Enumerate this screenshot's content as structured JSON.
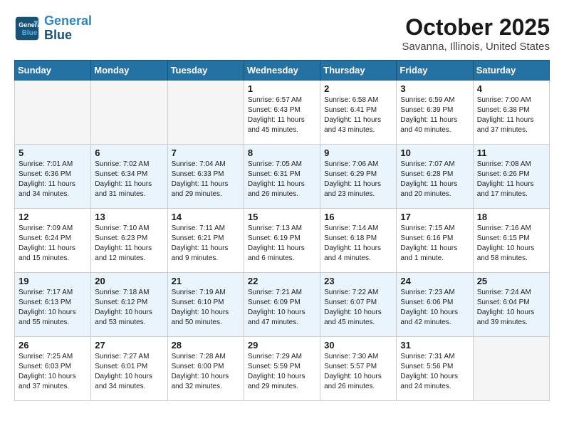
{
  "header": {
    "logo_line1": "General",
    "logo_line2": "Blue",
    "title": "October 2025",
    "subtitle": "Savanna, Illinois, United States"
  },
  "weekdays": [
    "Sunday",
    "Monday",
    "Tuesday",
    "Wednesday",
    "Thursday",
    "Friday",
    "Saturday"
  ],
  "weeks": [
    [
      {
        "day": "",
        "info": ""
      },
      {
        "day": "",
        "info": ""
      },
      {
        "day": "",
        "info": ""
      },
      {
        "day": "1",
        "info": "Sunrise: 6:57 AM\nSunset: 6:43 PM\nDaylight: 11 hours\nand 45 minutes."
      },
      {
        "day": "2",
        "info": "Sunrise: 6:58 AM\nSunset: 6:41 PM\nDaylight: 11 hours\nand 43 minutes."
      },
      {
        "day": "3",
        "info": "Sunrise: 6:59 AM\nSunset: 6:39 PM\nDaylight: 11 hours\nand 40 minutes."
      },
      {
        "day": "4",
        "info": "Sunrise: 7:00 AM\nSunset: 6:38 PM\nDaylight: 11 hours\nand 37 minutes."
      }
    ],
    [
      {
        "day": "5",
        "info": "Sunrise: 7:01 AM\nSunset: 6:36 PM\nDaylight: 11 hours\nand 34 minutes."
      },
      {
        "day": "6",
        "info": "Sunrise: 7:02 AM\nSunset: 6:34 PM\nDaylight: 11 hours\nand 31 minutes."
      },
      {
        "day": "7",
        "info": "Sunrise: 7:04 AM\nSunset: 6:33 PM\nDaylight: 11 hours\nand 29 minutes."
      },
      {
        "day": "8",
        "info": "Sunrise: 7:05 AM\nSunset: 6:31 PM\nDaylight: 11 hours\nand 26 minutes."
      },
      {
        "day": "9",
        "info": "Sunrise: 7:06 AM\nSunset: 6:29 PM\nDaylight: 11 hours\nand 23 minutes."
      },
      {
        "day": "10",
        "info": "Sunrise: 7:07 AM\nSunset: 6:28 PM\nDaylight: 11 hours\nand 20 minutes."
      },
      {
        "day": "11",
        "info": "Sunrise: 7:08 AM\nSunset: 6:26 PM\nDaylight: 11 hours\nand 17 minutes."
      }
    ],
    [
      {
        "day": "12",
        "info": "Sunrise: 7:09 AM\nSunset: 6:24 PM\nDaylight: 11 hours\nand 15 minutes."
      },
      {
        "day": "13",
        "info": "Sunrise: 7:10 AM\nSunset: 6:23 PM\nDaylight: 11 hours\nand 12 minutes."
      },
      {
        "day": "14",
        "info": "Sunrise: 7:11 AM\nSunset: 6:21 PM\nDaylight: 11 hours\nand 9 minutes."
      },
      {
        "day": "15",
        "info": "Sunrise: 7:13 AM\nSunset: 6:19 PM\nDaylight: 11 hours\nand 6 minutes."
      },
      {
        "day": "16",
        "info": "Sunrise: 7:14 AM\nSunset: 6:18 PM\nDaylight: 11 hours\nand 4 minutes."
      },
      {
        "day": "17",
        "info": "Sunrise: 7:15 AM\nSunset: 6:16 PM\nDaylight: 11 hours\nand 1 minute."
      },
      {
        "day": "18",
        "info": "Sunrise: 7:16 AM\nSunset: 6:15 PM\nDaylight: 10 hours\nand 58 minutes."
      }
    ],
    [
      {
        "day": "19",
        "info": "Sunrise: 7:17 AM\nSunset: 6:13 PM\nDaylight: 10 hours\nand 55 minutes."
      },
      {
        "day": "20",
        "info": "Sunrise: 7:18 AM\nSunset: 6:12 PM\nDaylight: 10 hours\nand 53 minutes."
      },
      {
        "day": "21",
        "info": "Sunrise: 7:19 AM\nSunset: 6:10 PM\nDaylight: 10 hours\nand 50 minutes."
      },
      {
        "day": "22",
        "info": "Sunrise: 7:21 AM\nSunset: 6:09 PM\nDaylight: 10 hours\nand 47 minutes."
      },
      {
        "day": "23",
        "info": "Sunrise: 7:22 AM\nSunset: 6:07 PM\nDaylight: 10 hours\nand 45 minutes."
      },
      {
        "day": "24",
        "info": "Sunrise: 7:23 AM\nSunset: 6:06 PM\nDaylight: 10 hours\nand 42 minutes."
      },
      {
        "day": "25",
        "info": "Sunrise: 7:24 AM\nSunset: 6:04 PM\nDaylight: 10 hours\nand 39 minutes."
      }
    ],
    [
      {
        "day": "26",
        "info": "Sunrise: 7:25 AM\nSunset: 6:03 PM\nDaylight: 10 hours\nand 37 minutes."
      },
      {
        "day": "27",
        "info": "Sunrise: 7:27 AM\nSunset: 6:01 PM\nDaylight: 10 hours\nand 34 minutes."
      },
      {
        "day": "28",
        "info": "Sunrise: 7:28 AM\nSunset: 6:00 PM\nDaylight: 10 hours\nand 32 minutes."
      },
      {
        "day": "29",
        "info": "Sunrise: 7:29 AM\nSunset: 5:59 PM\nDaylight: 10 hours\nand 29 minutes."
      },
      {
        "day": "30",
        "info": "Sunrise: 7:30 AM\nSunset: 5:57 PM\nDaylight: 10 hours\nand 26 minutes."
      },
      {
        "day": "31",
        "info": "Sunrise: 7:31 AM\nSunset: 5:56 PM\nDaylight: 10 hours\nand 24 minutes."
      },
      {
        "day": "",
        "info": ""
      }
    ]
  ]
}
